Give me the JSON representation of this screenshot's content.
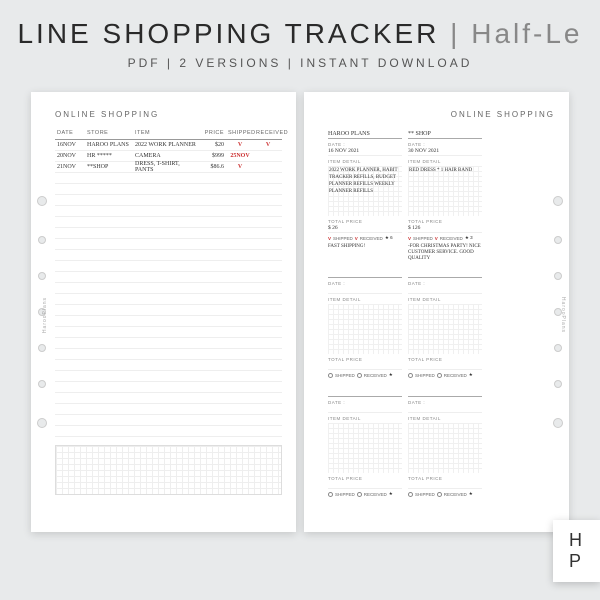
{
  "header": {
    "title_left": "LINE SHOPPING TRACKER",
    "title_right": "Half-Le",
    "subtitle": "PDF | 2 VERSIONS | INSTANT DOWNLOAD"
  },
  "page_title": "ONLINE SHOPPING",
  "brand": "HarooPlans",
  "table": {
    "headers": {
      "date": "DATE",
      "store": "STORE",
      "item": "ITEM",
      "price": "PRICE",
      "shipped": "SHIPPED",
      "received": "RECEIVED"
    },
    "rows": [
      {
        "date": "16NOV",
        "store": "HAROO PLANS",
        "item": "2022 WORK PLANNER",
        "price": "$20",
        "shipped": "V",
        "received": "V"
      },
      {
        "date": "20NOV",
        "store": "HR *****",
        "item": "CAMERA",
        "price": "$999",
        "shipped": "25NOV",
        "received": ""
      },
      {
        "date": "21NOV",
        "store": "**SHOP",
        "item": "DRESS, T-SHIRT, PANTS",
        "price": "$86.6",
        "shipped": "V",
        "received": ""
      }
    ]
  },
  "cards": [
    {
      "store": "HAROO PLANS",
      "date": "16 NOV 2021",
      "detail": "2022 WORK PLANNER, HABIT TRACKER REFILLS, BUDGET PLANNER REFILLS WEEKLY PLANNER REFILLS",
      "total": "$ 26",
      "shipped": true,
      "received": true,
      "rating": "★ 6",
      "note": "FAST SHIPPING!"
    },
    {
      "store": "** SHOP",
      "date": "30 NOV 2021",
      "detail": "RED DRESS * 1 HAIR BAND",
      "total": "$ 126",
      "shipped": true,
      "received": true,
      "rating": "★ 3",
      "note": "-FOR CHRISTMAS PARTY! NICE CUSTOMER SERVICE. GOOD QUALITY"
    },
    {
      "store": "",
      "date": "",
      "detail": "",
      "total": "",
      "shipped": false,
      "received": false,
      "rating": "★",
      "note": ""
    },
    {
      "store": "",
      "date": "",
      "detail": "",
      "total": "",
      "shipped": false,
      "received": false,
      "rating": "★",
      "note": ""
    },
    {
      "store": "",
      "date": "",
      "detail": "",
      "total": "",
      "shipped": false,
      "received": false,
      "rating": "★",
      "note": ""
    },
    {
      "store": "",
      "date": "",
      "detail": "",
      "total": "",
      "shipped": false,
      "received": false,
      "rating": "★",
      "note": ""
    }
  ],
  "labels": {
    "date": "DATE :",
    "item_detail": "ITEM DETAIL",
    "total": "TOTAL PRICE",
    "shipped": "SHIPPED",
    "received": "RECEIVED"
  },
  "badge": "H\nP"
}
